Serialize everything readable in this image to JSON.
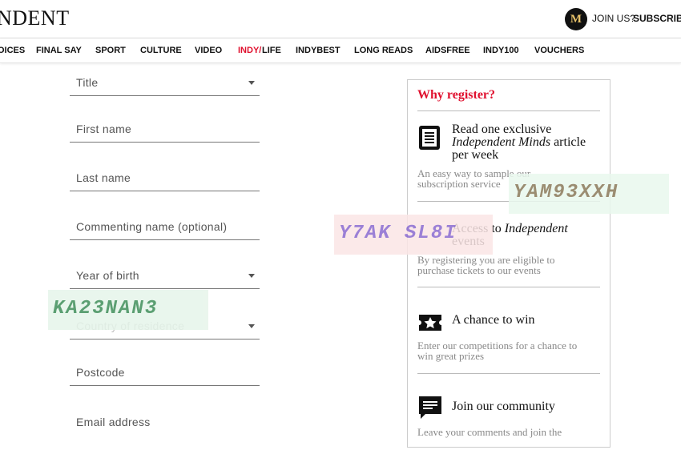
{
  "header": {
    "logo": "NDENT",
    "badge": "M",
    "join": "JOIN US?",
    "subscribe": "SUBSCRIBE"
  },
  "nav": {
    "items": [
      "OICES",
      "FINAL SAY",
      "SPORT",
      "CULTURE",
      "VIDEO",
      "INDY/",
      "LIFE",
      "INDYBEST",
      "LONG READS",
      "AIDSFREE",
      "INDY100",
      "VOUCHERS"
    ]
  },
  "form": {
    "title": "Title",
    "first_name": "First name",
    "last_name": "Last name",
    "commenting_name": "Commenting name (optional)",
    "year_of_birth": "Year of birth",
    "country": "Country of residence",
    "postcode": "Postcode",
    "email": "Email address"
  },
  "panel": {
    "heading": "Why register?",
    "items": [
      {
        "title_a": "Read one exclusive",
        "title_b": "Independent Minds",
        "title_c": " article",
        "title_d": "per week",
        "desc_a": "An easy way to sample our",
        "desc_b": "subscription service"
      },
      {
        "title_a": "Access to",
        "title_b": "Independent",
        "title_c": "events",
        "desc_a": "By registering you are eligible to",
        "desc_b": "purchase tickets to our events"
      },
      {
        "title": "A chance to win",
        "desc_a": "Enter our competitions for a chance to",
        "desc_b": "win great prizes"
      },
      {
        "title": "Join our community",
        "desc_a": "Leave your comments and join the"
      }
    ]
  },
  "captchas": [
    "YAM93XXH",
    "Y7AK SL8I",
    "KA23NAN3"
  ],
  "colors": {
    "accent": "#e0102e",
    "badge_gold": "#e8c26a"
  }
}
